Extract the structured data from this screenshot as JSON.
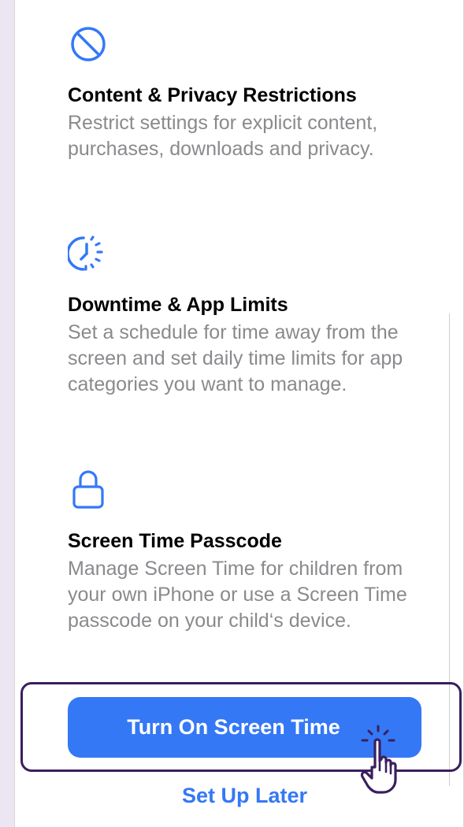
{
  "features": [
    {
      "icon": "restrictions-icon",
      "title": "Content & Privacy Restrictions",
      "description": "Restrict settings for explicit content, purchases, downloads and privacy."
    },
    {
      "icon": "downtime-icon",
      "title": "Downtime & App Limits",
      "description": "Set a schedule for time away from the screen and set daily time limits for app categories you want to manage."
    },
    {
      "icon": "lock-icon",
      "title": "Screen Time Passcode",
      "description": "Manage Screen Time for children from your own iPhone or use a Screen Time passcode on your child‘s device."
    }
  ],
  "actions": {
    "primary_label": "Turn On Screen Time",
    "secondary_label": "Set Up Later"
  },
  "colors": {
    "accent": "#3478f6",
    "highlight": "#3a1f5d",
    "secondary_text": "#8a8a8e",
    "backdrop": "#ece6f2"
  }
}
